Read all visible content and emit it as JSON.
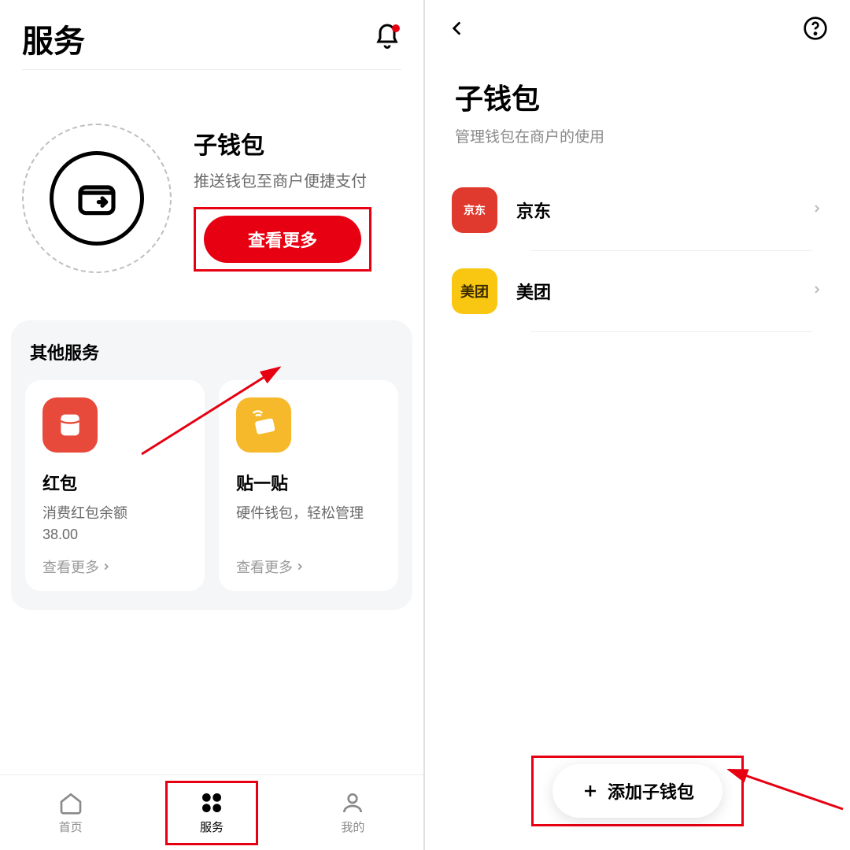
{
  "left": {
    "page_title": "服务",
    "hero": {
      "title": "子钱包",
      "subtitle": "推送钱包至商户便捷支付",
      "button": "查看更多"
    },
    "other_section_title": "其他服务",
    "cards": [
      {
        "title": "红包",
        "desc_line1": "消费红包余额",
        "desc_line2": "38.00",
        "link": "查看更多"
      },
      {
        "title": "贴一贴",
        "desc_line1": "硬件钱包，轻松管理",
        "desc_line2": "",
        "link": "查看更多"
      }
    ],
    "tabs": {
      "home": "首页",
      "services": "服务",
      "mine": "我的"
    }
  },
  "right": {
    "title": "子钱包",
    "subtitle": "管理钱包在商户的使用",
    "merchants": [
      {
        "name": "京东",
        "icon_label": "京东"
      },
      {
        "name": "美团",
        "icon_label": "美团"
      }
    ],
    "add_button": "添加子钱包"
  },
  "annotation": {
    "highlight_color": "#e60012"
  }
}
